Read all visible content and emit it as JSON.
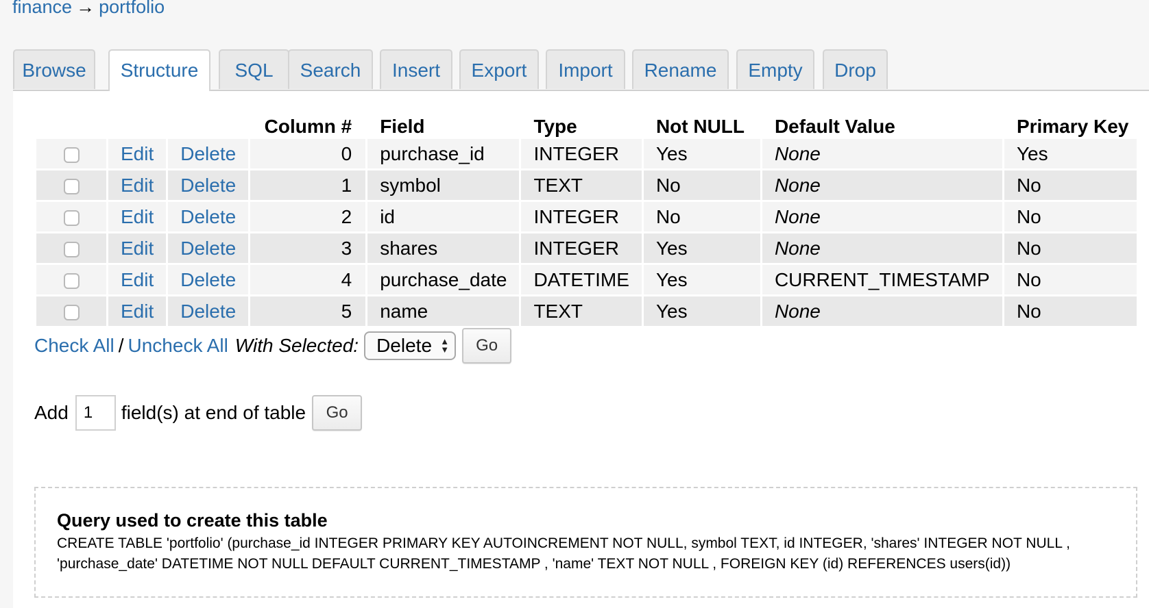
{
  "breadcrumb": {
    "database": "finance",
    "separator": "→",
    "table": "portfolio"
  },
  "tabs": [
    {
      "label": "Browse",
      "active": false
    },
    {
      "label": "Structure",
      "active": true
    },
    {
      "label": "SQL",
      "active": false
    },
    {
      "label": "Search",
      "active": false
    },
    {
      "label": "Insert",
      "active": false
    },
    {
      "label": "Export",
      "active": false
    },
    {
      "label": "Import",
      "active": false
    },
    {
      "label": "Rename",
      "active": false
    },
    {
      "label": "Empty",
      "active": false
    },
    {
      "label": "Drop",
      "active": false
    }
  ],
  "table": {
    "headers": {
      "column_num": "Column #",
      "field": "Field",
      "type": "Type",
      "not_null": "Not NULL",
      "default_value": "Default Value",
      "primary_key": "Primary Key"
    },
    "edit_label": "Edit",
    "delete_label": "Delete",
    "rows": [
      {
        "num": "0",
        "field": "purchase_id",
        "type": "INTEGER",
        "not_null": "Yes",
        "default": "None",
        "default_is_none": true,
        "pk": "Yes",
        "checked": false
      },
      {
        "num": "1",
        "field": "symbol",
        "type": "TEXT",
        "not_null": "No",
        "default": "None",
        "default_is_none": true,
        "pk": "No",
        "checked": false
      },
      {
        "num": "2",
        "field": "id",
        "type": "INTEGER",
        "not_null": "No",
        "default": "None",
        "default_is_none": true,
        "pk": "No",
        "checked": false
      },
      {
        "num": "3",
        "field": "shares",
        "type": "INTEGER",
        "not_null": "Yes",
        "default": "None",
        "default_is_none": true,
        "pk": "No",
        "checked": false
      },
      {
        "num": "4",
        "field": "purchase_date",
        "type": "DATETIME",
        "not_null": "Yes",
        "default": "CURRENT_TIMESTAMP",
        "default_is_none": false,
        "pk": "No",
        "checked": false
      },
      {
        "num": "5",
        "field": "name",
        "type": "TEXT",
        "not_null": "Yes",
        "default": "None",
        "default_is_none": true,
        "pk": "No",
        "checked": false
      }
    ]
  },
  "bulk": {
    "check_all": "Check All",
    "slash": "/",
    "uncheck_all": "Uncheck All",
    "with_selected": "With Selected:",
    "action_selected": "Delete",
    "go_label": "Go"
  },
  "add_field": {
    "prefix": "Add",
    "count_value": "1",
    "suffix": "field(s) at end of table",
    "go_label": "Go"
  },
  "query": {
    "title": "Query used to create this table",
    "sql": "CREATE TABLE 'portfolio' (purchase_id INTEGER PRIMARY KEY AUTOINCREMENT NOT NULL, symbol TEXT, id INTEGER, 'shares' INTEGER NOT NULL , 'purchase_date' DATETIME NOT NULL DEFAULT CURRENT_TIMESTAMP , 'name' TEXT NOT NULL , FOREIGN KEY (id) REFERENCES users(id))"
  },
  "colors": {
    "link": "#2a6ead",
    "page_bg": "#f6f6f6",
    "row_odd": "#f4f4f4",
    "row_even": "#e8e8e8"
  }
}
